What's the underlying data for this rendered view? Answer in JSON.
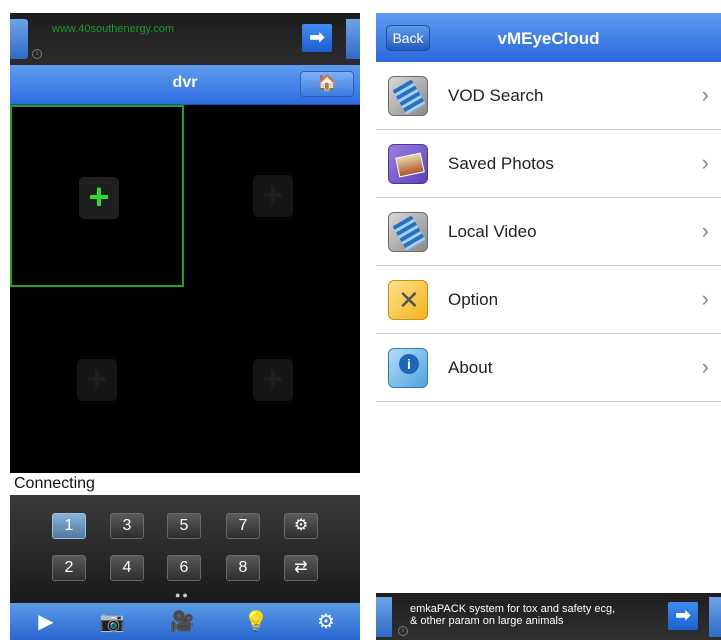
{
  "left": {
    "ad": {
      "url": "www.40southenergy.com",
      "info_glyph": "i",
      "go_glyph": "➡"
    },
    "title": "dvr",
    "home_glyph": "🏠",
    "cells": [
      {
        "plus": "+",
        "selected": true
      },
      {
        "plus": "+",
        "selected": false
      },
      {
        "plus": "+",
        "selected": false
      },
      {
        "plus": "+",
        "selected": false
      }
    ],
    "status": "Connecting",
    "keys": [
      "1",
      "3",
      "5",
      "7",
      "2",
      "4",
      "6",
      "8"
    ],
    "settings_glyph": "⚙",
    "switch_glyph": "⇄",
    "page_dots": "●●",
    "toolbar": {
      "play": "▶",
      "camera": "📷",
      "record": "🎥",
      "light": "💡",
      "settings": "⚙"
    }
  },
  "right": {
    "title": "vMEyeCloud",
    "back_label": "Back",
    "menu": [
      {
        "label": "VOD Search",
        "icon": "film-reel-icon"
      },
      {
        "label": "Saved Photos",
        "icon": "photos-icon"
      },
      {
        "label": "Local Video",
        "icon": "film-reel-icon"
      },
      {
        "label": "Option",
        "icon": "tools-icon"
      },
      {
        "label": "About",
        "icon": "info-icon"
      }
    ],
    "chevron": "›",
    "ad": {
      "line1": "emkaPACK system for tox and safety ecg,",
      "line2": "& other param on large animals",
      "info_glyph": "i",
      "go_glyph": "➡"
    }
  }
}
